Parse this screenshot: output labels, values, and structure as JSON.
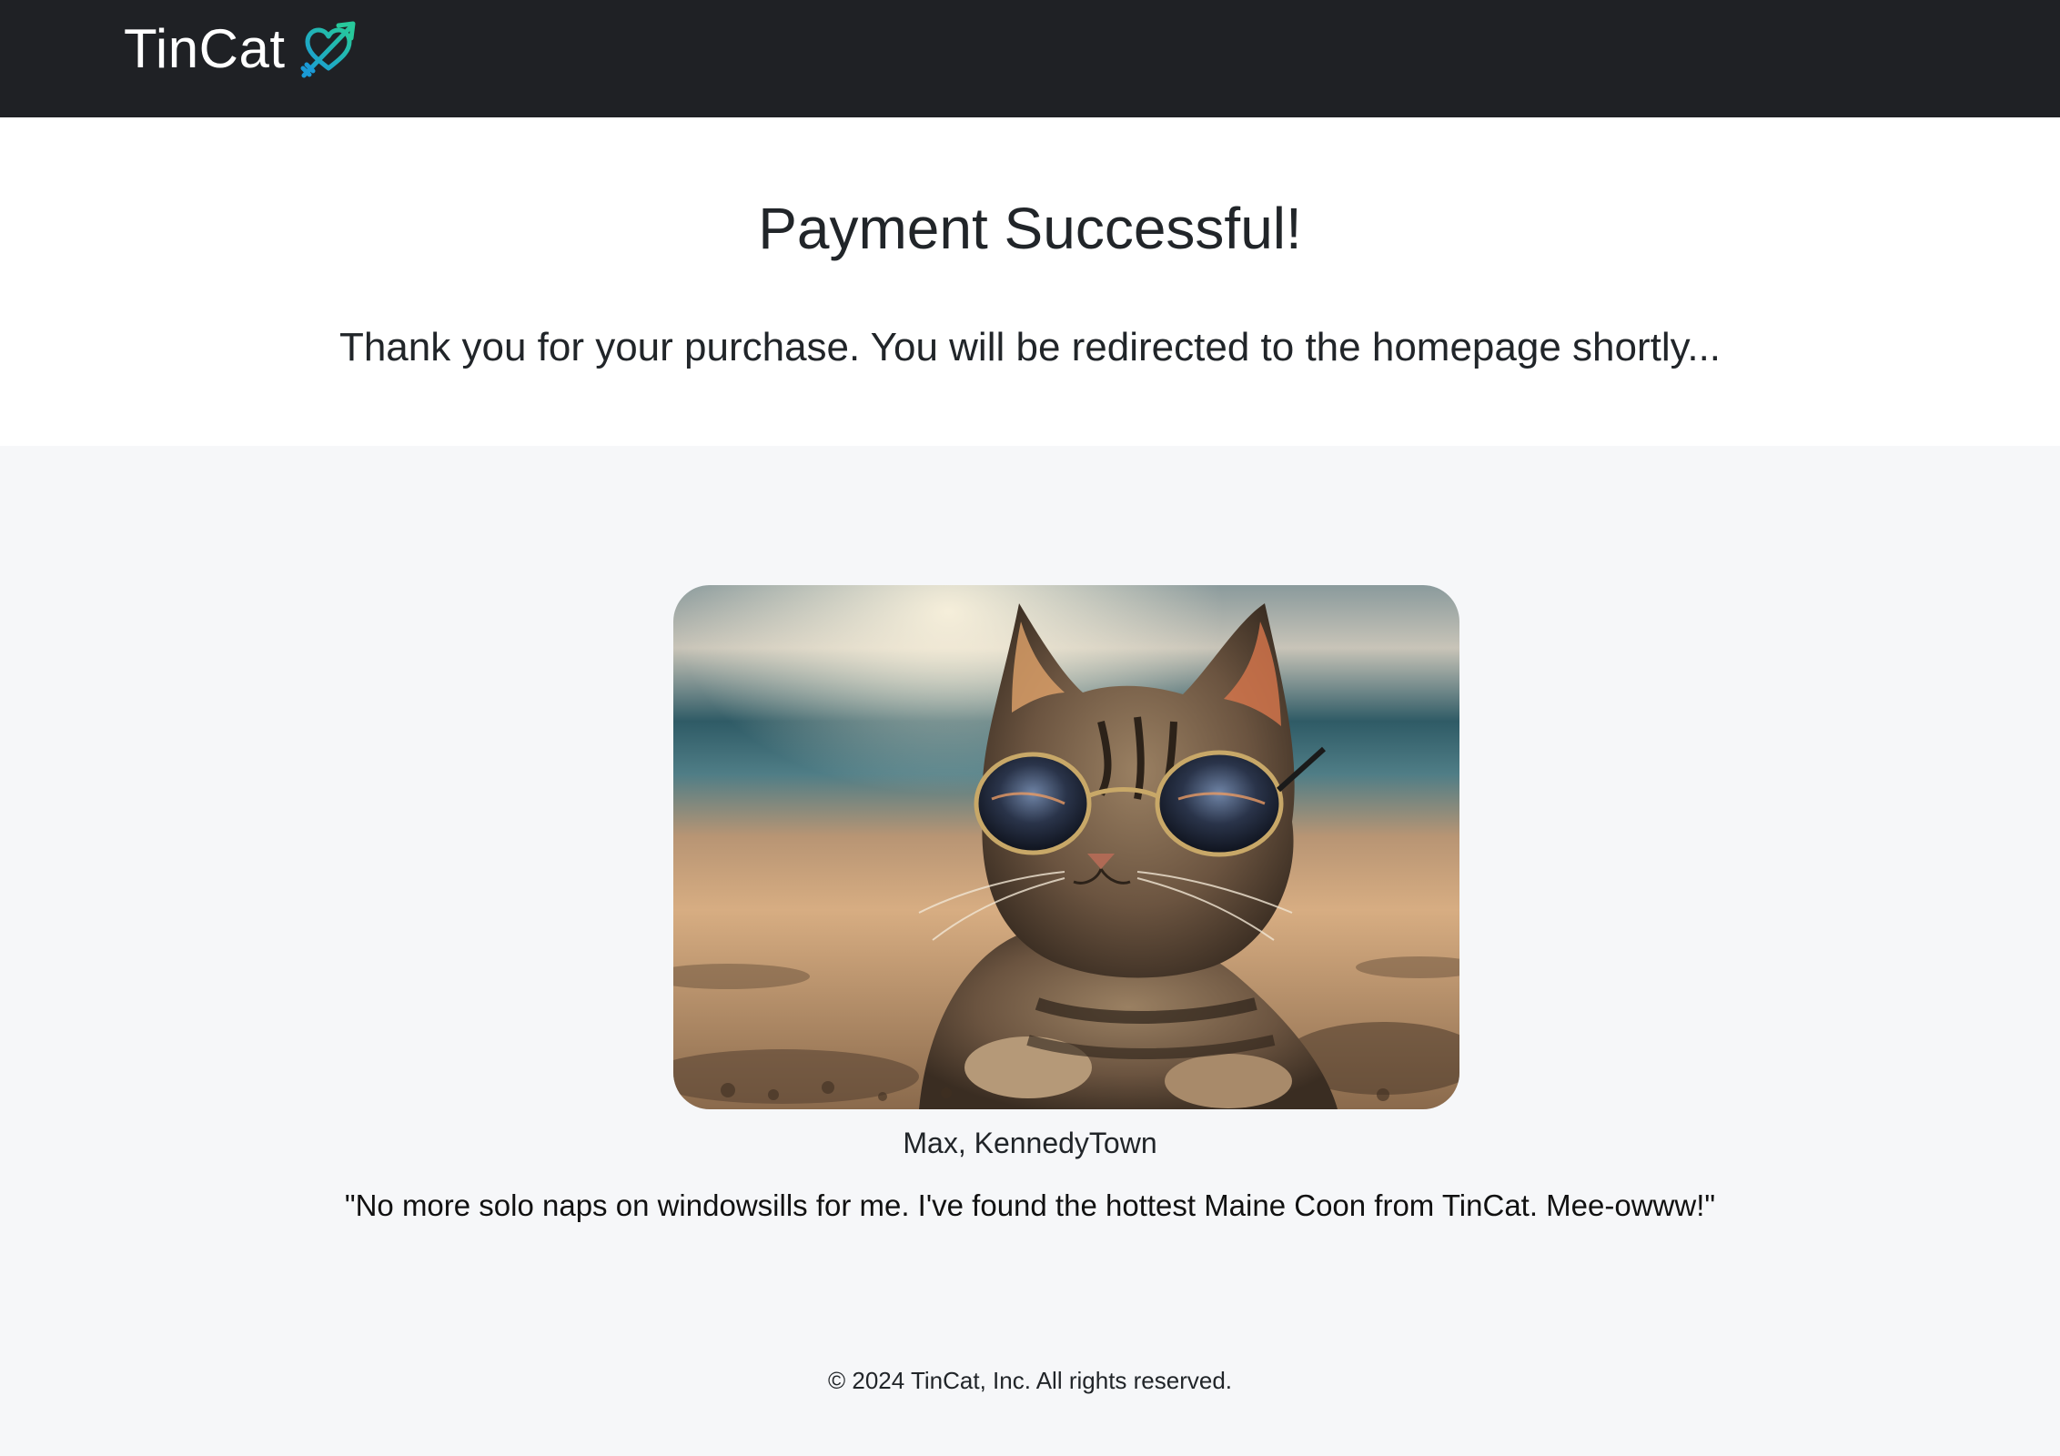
{
  "navbar": {
    "brand": "TinCat",
    "logo_icon": "heart-arrow-icon",
    "logo_colors": [
      "#27c99b",
      "#1a9ad6"
    ]
  },
  "hero": {
    "title": "Payment Successful!",
    "subtitle": "Thank you for your purchase. You will be redirected to the homepage shortly..."
  },
  "testimonial": {
    "image_icon": "cat-with-sunglasses-photo",
    "caption": "Max, KennedyTown",
    "quote": "\"No more solo naps on windowsills for me. I've found the hottest Maine Coon from TinCat. Mee-owww!\""
  },
  "footer": {
    "copyright": "© 2024 TinCat, Inc. All rights reserved."
  },
  "colors": {
    "navbar_bg": "#1f2125",
    "page_bg": "#f6f7f9",
    "hero_bg": "#ffffff",
    "text": "#212529"
  }
}
